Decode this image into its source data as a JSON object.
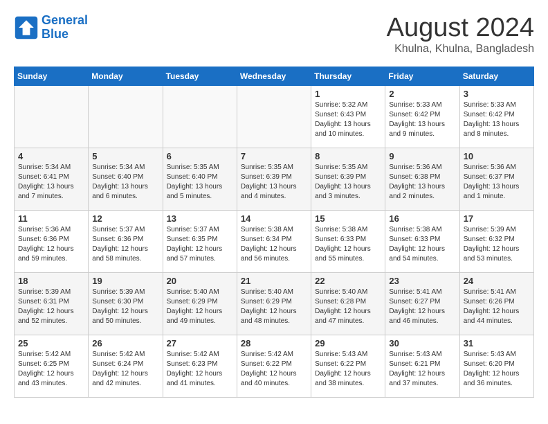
{
  "header": {
    "logo_line1": "General",
    "logo_line2": "Blue",
    "month_year": "August 2024",
    "location": "Khulna, Khulna, Bangladesh"
  },
  "days_of_week": [
    "Sunday",
    "Monday",
    "Tuesday",
    "Wednesday",
    "Thursday",
    "Friday",
    "Saturday"
  ],
  "weeks": [
    [
      {
        "day": "",
        "sunrise": "",
        "sunset": "",
        "daylight": ""
      },
      {
        "day": "",
        "sunrise": "",
        "sunset": "",
        "daylight": ""
      },
      {
        "day": "",
        "sunrise": "",
        "sunset": "",
        "daylight": ""
      },
      {
        "day": "",
        "sunrise": "",
        "sunset": "",
        "daylight": ""
      },
      {
        "day": "1",
        "sunrise": "Sunrise: 5:32 AM",
        "sunset": "Sunset: 6:43 PM",
        "daylight": "Daylight: 13 hours and 10 minutes."
      },
      {
        "day": "2",
        "sunrise": "Sunrise: 5:33 AM",
        "sunset": "Sunset: 6:42 PM",
        "daylight": "Daylight: 13 hours and 9 minutes."
      },
      {
        "day": "3",
        "sunrise": "Sunrise: 5:33 AM",
        "sunset": "Sunset: 6:42 PM",
        "daylight": "Daylight: 13 hours and 8 minutes."
      }
    ],
    [
      {
        "day": "4",
        "sunrise": "Sunrise: 5:34 AM",
        "sunset": "Sunset: 6:41 PM",
        "daylight": "Daylight: 13 hours and 7 minutes."
      },
      {
        "day": "5",
        "sunrise": "Sunrise: 5:34 AM",
        "sunset": "Sunset: 6:40 PM",
        "daylight": "Daylight: 13 hours and 6 minutes."
      },
      {
        "day": "6",
        "sunrise": "Sunrise: 5:35 AM",
        "sunset": "Sunset: 6:40 PM",
        "daylight": "Daylight: 13 hours and 5 minutes."
      },
      {
        "day": "7",
        "sunrise": "Sunrise: 5:35 AM",
        "sunset": "Sunset: 6:39 PM",
        "daylight": "Daylight: 13 hours and 4 minutes."
      },
      {
        "day": "8",
        "sunrise": "Sunrise: 5:35 AM",
        "sunset": "Sunset: 6:39 PM",
        "daylight": "Daylight: 13 hours and 3 minutes."
      },
      {
        "day": "9",
        "sunrise": "Sunrise: 5:36 AM",
        "sunset": "Sunset: 6:38 PM",
        "daylight": "Daylight: 13 hours and 2 minutes."
      },
      {
        "day": "10",
        "sunrise": "Sunrise: 5:36 AM",
        "sunset": "Sunset: 6:37 PM",
        "daylight": "Daylight: 13 hours and 1 minute."
      }
    ],
    [
      {
        "day": "11",
        "sunrise": "Sunrise: 5:36 AM",
        "sunset": "Sunset: 6:36 PM",
        "daylight": "Daylight: 12 hours and 59 minutes."
      },
      {
        "day": "12",
        "sunrise": "Sunrise: 5:37 AM",
        "sunset": "Sunset: 6:36 PM",
        "daylight": "Daylight: 12 hours and 58 minutes."
      },
      {
        "day": "13",
        "sunrise": "Sunrise: 5:37 AM",
        "sunset": "Sunset: 6:35 PM",
        "daylight": "Daylight: 12 hours and 57 minutes."
      },
      {
        "day": "14",
        "sunrise": "Sunrise: 5:38 AM",
        "sunset": "Sunset: 6:34 PM",
        "daylight": "Daylight: 12 hours and 56 minutes."
      },
      {
        "day": "15",
        "sunrise": "Sunrise: 5:38 AM",
        "sunset": "Sunset: 6:33 PM",
        "daylight": "Daylight: 12 hours and 55 minutes."
      },
      {
        "day": "16",
        "sunrise": "Sunrise: 5:38 AM",
        "sunset": "Sunset: 6:33 PM",
        "daylight": "Daylight: 12 hours and 54 minutes."
      },
      {
        "day": "17",
        "sunrise": "Sunrise: 5:39 AM",
        "sunset": "Sunset: 6:32 PM",
        "daylight": "Daylight: 12 hours and 53 minutes."
      }
    ],
    [
      {
        "day": "18",
        "sunrise": "Sunrise: 5:39 AM",
        "sunset": "Sunset: 6:31 PM",
        "daylight": "Daylight: 12 hours and 52 minutes."
      },
      {
        "day": "19",
        "sunrise": "Sunrise: 5:39 AM",
        "sunset": "Sunset: 6:30 PM",
        "daylight": "Daylight: 12 hours and 50 minutes."
      },
      {
        "day": "20",
        "sunrise": "Sunrise: 5:40 AM",
        "sunset": "Sunset: 6:29 PM",
        "daylight": "Daylight: 12 hours and 49 minutes."
      },
      {
        "day": "21",
        "sunrise": "Sunrise: 5:40 AM",
        "sunset": "Sunset: 6:29 PM",
        "daylight": "Daylight: 12 hours and 48 minutes."
      },
      {
        "day": "22",
        "sunrise": "Sunrise: 5:40 AM",
        "sunset": "Sunset: 6:28 PM",
        "daylight": "Daylight: 12 hours and 47 minutes."
      },
      {
        "day": "23",
        "sunrise": "Sunrise: 5:41 AM",
        "sunset": "Sunset: 6:27 PM",
        "daylight": "Daylight: 12 hours and 46 minutes."
      },
      {
        "day": "24",
        "sunrise": "Sunrise: 5:41 AM",
        "sunset": "Sunset: 6:26 PM",
        "daylight": "Daylight: 12 hours and 44 minutes."
      }
    ],
    [
      {
        "day": "25",
        "sunrise": "Sunrise: 5:42 AM",
        "sunset": "Sunset: 6:25 PM",
        "daylight": "Daylight: 12 hours and 43 minutes."
      },
      {
        "day": "26",
        "sunrise": "Sunrise: 5:42 AM",
        "sunset": "Sunset: 6:24 PM",
        "daylight": "Daylight: 12 hours and 42 minutes."
      },
      {
        "day": "27",
        "sunrise": "Sunrise: 5:42 AM",
        "sunset": "Sunset: 6:23 PM",
        "daylight": "Daylight: 12 hours and 41 minutes."
      },
      {
        "day": "28",
        "sunrise": "Sunrise: 5:42 AM",
        "sunset": "Sunset: 6:22 PM",
        "daylight": "Daylight: 12 hours and 40 minutes."
      },
      {
        "day": "29",
        "sunrise": "Sunrise: 5:43 AM",
        "sunset": "Sunset: 6:22 PM",
        "daylight": "Daylight: 12 hours and 38 minutes."
      },
      {
        "day": "30",
        "sunrise": "Sunrise: 5:43 AM",
        "sunset": "Sunset: 6:21 PM",
        "daylight": "Daylight: 12 hours and 37 minutes."
      },
      {
        "day": "31",
        "sunrise": "Sunrise: 5:43 AM",
        "sunset": "Sunset: 6:20 PM",
        "daylight": "Daylight: 12 hours and 36 minutes."
      }
    ]
  ]
}
